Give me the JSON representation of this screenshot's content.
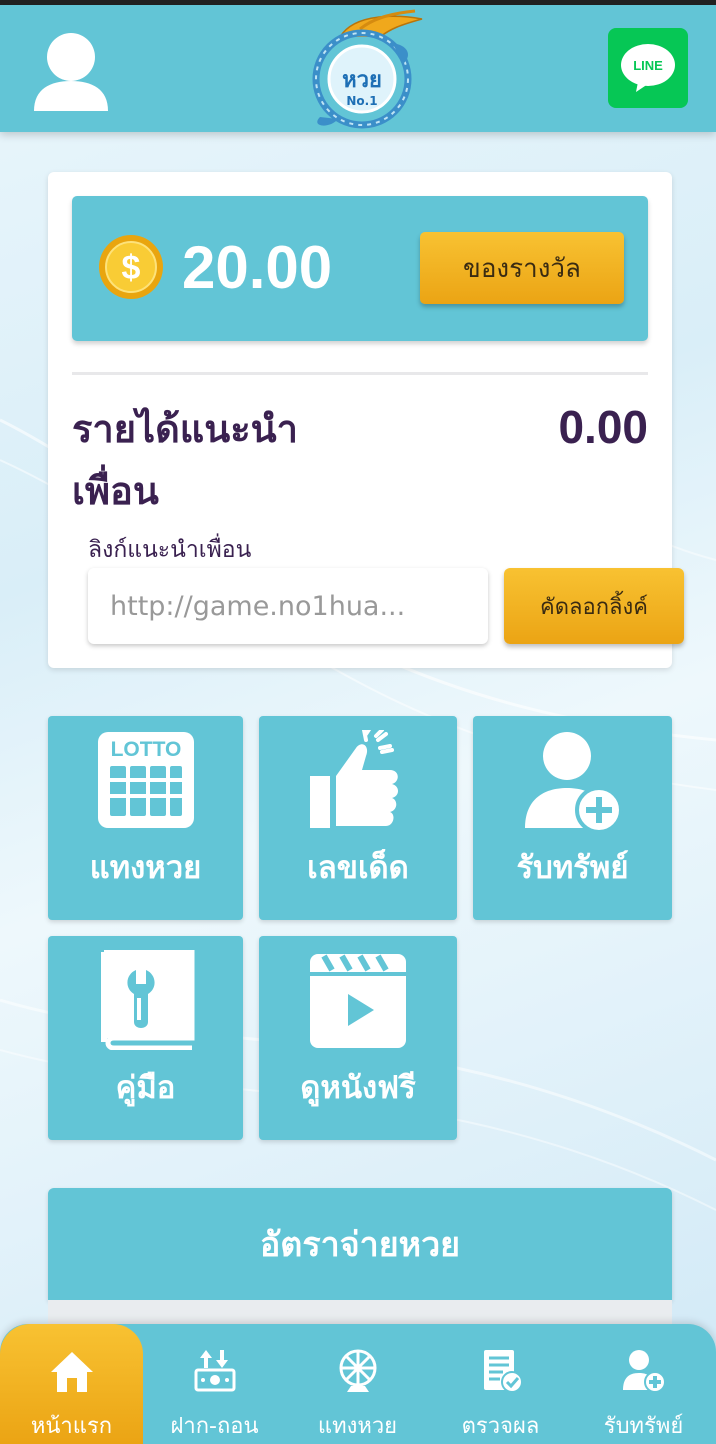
{
  "header": {
    "logo_text": "หวย",
    "logo_subtext": "No.1",
    "line_label": "LINE"
  },
  "wallet": {
    "balance": "20.00",
    "reward_button": "ของรางวัล"
  },
  "referral": {
    "title": "รายได้แนะนำเพื่อน",
    "amount": "0.00",
    "link_label": "ลิงก์แนะนำเพื่อน",
    "link_value": "http://game.no1hua...",
    "copy_button": "คัดลอกลิ้งค์"
  },
  "menu": {
    "lotto_icon_text": "LOTTO",
    "items": [
      {
        "label": "แทงหวย",
        "icon": "lotto-ticket-icon"
      },
      {
        "label": "เลขเด็ด",
        "icon": "thumbs-up-icon"
      },
      {
        "label": "รับทรัพย์",
        "icon": "add-user-icon"
      },
      {
        "label": "คู่มือ",
        "icon": "manual-book-icon"
      },
      {
        "label": "ดูหนังฟรี",
        "icon": "video-play-icon"
      }
    ]
  },
  "rates": {
    "title": "อัตราจ่ายหวย"
  },
  "bottom_nav": {
    "items": [
      {
        "label": "หน้าแรก",
        "icon": "home-icon",
        "active": true
      },
      {
        "label": "ฝาก-ถอน",
        "icon": "deposit-withdraw-icon",
        "active": false
      },
      {
        "label": "แทงหวย",
        "icon": "lottery-wheel-icon",
        "active": false
      },
      {
        "label": "ตรวจผล",
        "icon": "check-result-icon",
        "active": false
      },
      {
        "label": "รับทรัพย์",
        "icon": "add-user-icon",
        "active": false
      }
    ]
  },
  "colors": {
    "primary": "#62c5d6",
    "accent": "#f2b324",
    "text_dark": "#3a2150",
    "line_green": "#06c755"
  }
}
